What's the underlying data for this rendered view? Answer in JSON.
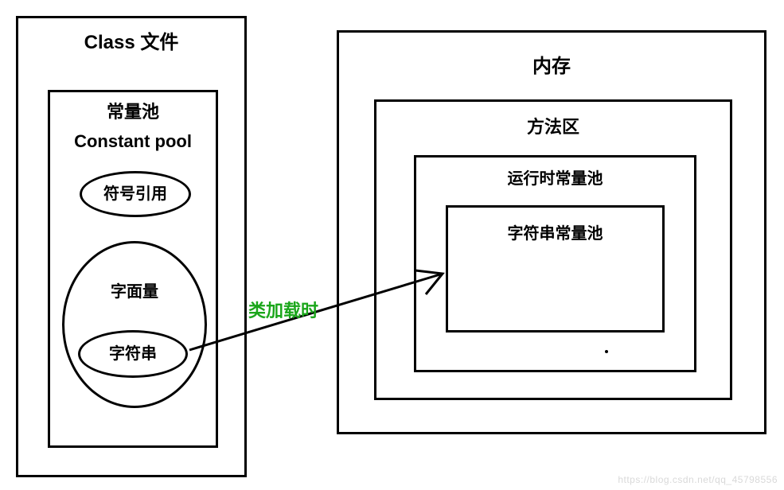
{
  "classFile": {
    "title": "Class 文件",
    "constantPool": {
      "title_cn": "常量池",
      "title_en": "Constant pool",
      "symbolRef": "符号引用",
      "literal": "字面量",
      "string": "字符串"
    }
  },
  "memory": {
    "title": "内存",
    "methodArea": {
      "title": "方法区",
      "runtimeConstPool": {
        "title": "运行时常量池",
        "stringConstPool": {
          "title": "字符串常量池"
        }
      }
    }
  },
  "arrowLabel": "类加载时",
  "watermark": "https://blog.csdn.net/qq_45798556"
}
